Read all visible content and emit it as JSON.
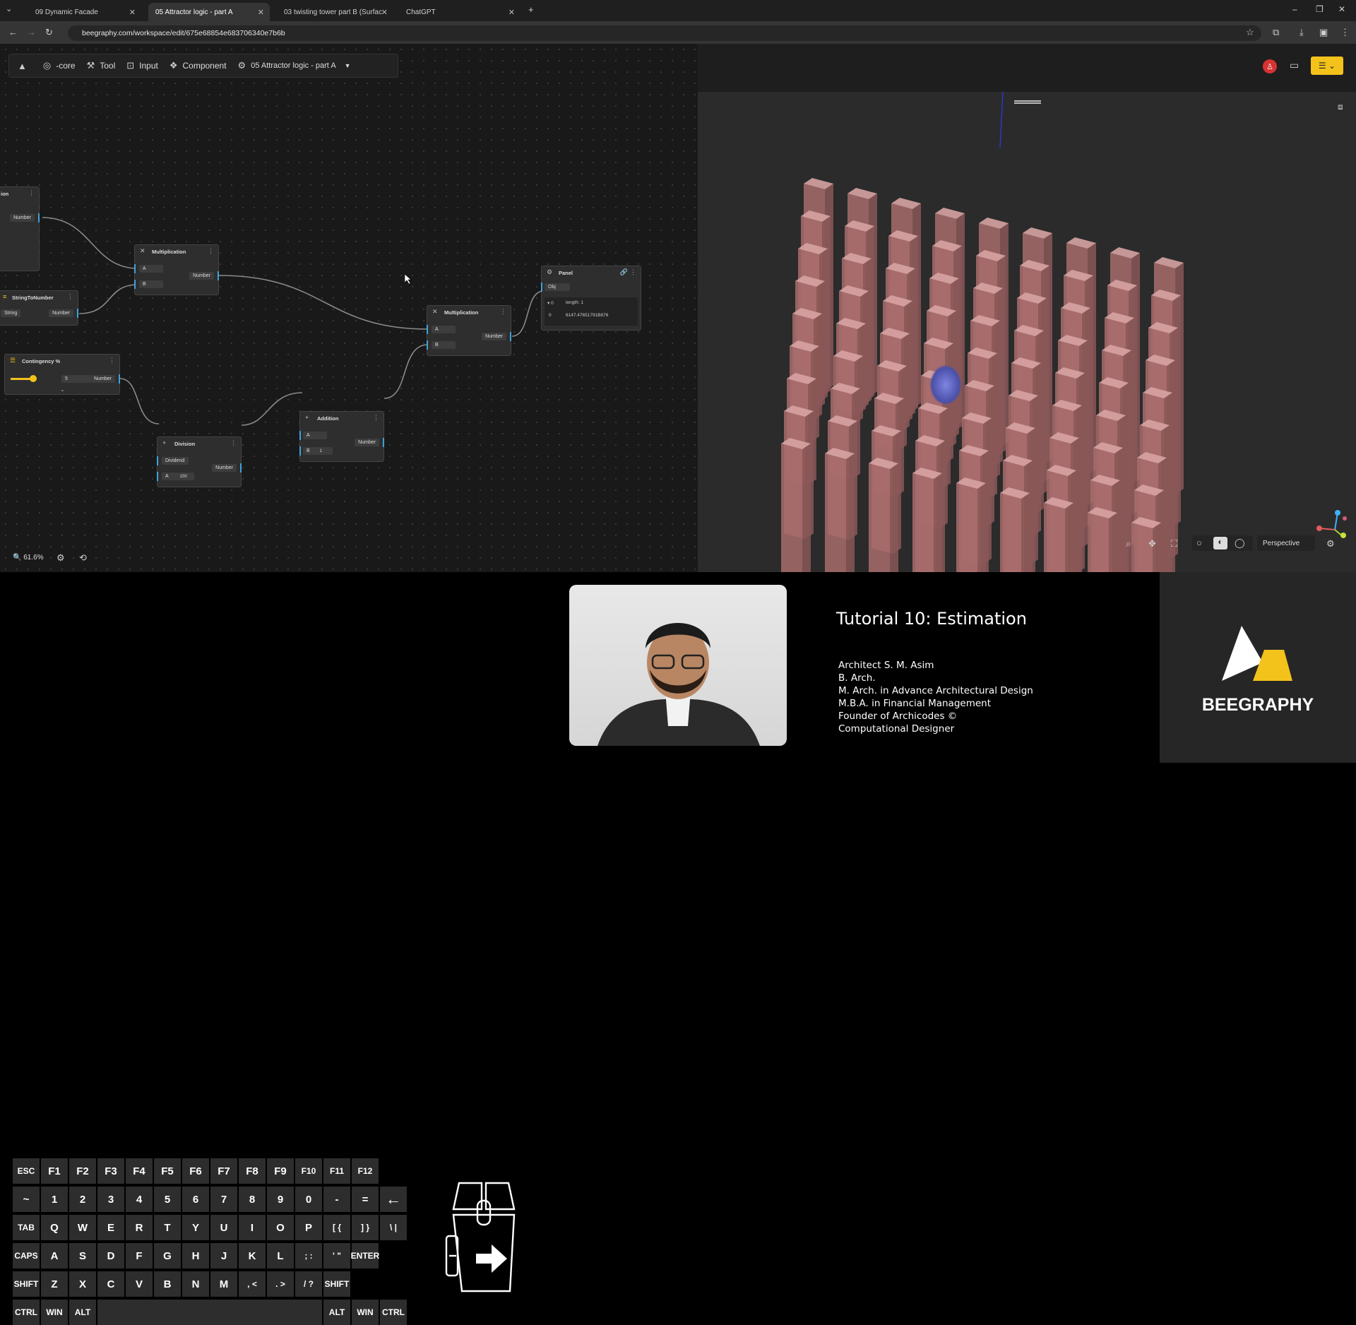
{
  "browser": {
    "tabs": [
      {
        "title": "09 Dynamic Facade",
        "active": false
      },
      {
        "title": "05 Attractor logic - part A",
        "active": true
      },
      {
        "title": "03 twisting tower part B (Surfac",
        "active": false
      },
      {
        "title": "ChatGPT",
        "active": false
      }
    ],
    "url": "beegraphy.com/workspace/edit/675e68854e683706340e7b6b"
  },
  "toolbar": {
    "core_label": "-core",
    "tool_label": "Tool",
    "input_label": "Input",
    "component_label": "Component",
    "file_label": "05 Attractor logic - part A"
  },
  "nodes": {
    "partial_top": {
      "title": "ion",
      "out": "Number"
    },
    "string_to_number": {
      "title": "StringToNumber",
      "in": "String",
      "out": "Number"
    },
    "contingency": {
      "title": "Contingency %",
      "value": "5",
      "out": "Number"
    },
    "multiplication1": {
      "title": "Multiplication",
      "a": "A",
      "b": "B",
      "out": "Number"
    },
    "division": {
      "title": "Division",
      "dividend": "Dividend",
      "a": "A",
      "a_val": "100",
      "out": "Number"
    },
    "addition": {
      "title": "Addition",
      "a": "A",
      "b": "B",
      "b_val": "1",
      "out": "Number"
    },
    "multiplication2": {
      "title": "Multiplication",
      "a": "A",
      "b": "B",
      "out": "Number"
    },
    "panel": {
      "title": "Panel",
      "obj": "Obj",
      "row1_key": "▾ 0",
      "row1_val": "length: 1",
      "row2_key": "0",
      "row2_val": "6147.47651791B876"
    }
  },
  "editor": {
    "zoom": "61.6%"
  },
  "viewport": {
    "camera": "Perspective"
  },
  "keyboard": {
    "rows": [
      [
        "ESC",
        "F1",
        "F2",
        "F3",
        "F4",
        "F5",
        "F6",
        "F7",
        "F8",
        "F9",
        "F10",
        "F11",
        "F12"
      ],
      [
        "~",
        "1",
        "2",
        "3",
        "4",
        "5",
        "6",
        "7",
        "8",
        "9",
        "0",
        "-",
        "=",
        "←"
      ],
      [
        "TAB",
        "Q",
        "W",
        "E",
        "R",
        "T",
        "Y",
        "U",
        "I",
        "O",
        "P",
        "[ {",
        "] }",
        "\\ |"
      ],
      [
        "CAPS",
        "A",
        "S",
        "D",
        "F",
        "G",
        "H",
        "J",
        "K",
        "L",
        "; :",
        "' \"",
        "ENTER"
      ],
      [
        "SHIFT",
        "Z",
        "X",
        "C",
        "V",
        "B",
        "N",
        "M",
        ", <",
        ". >",
        "/ ?",
        "SHIFT"
      ],
      [
        "CTRL",
        "WIN",
        "ALT",
        "ALT",
        "WIN",
        "CTRL"
      ]
    ]
  },
  "tutorial": {
    "title": "Tutorial 10: Estimation",
    "credits": [
      "Architect S. M. Asim",
      "B. Arch.",
      "M. Arch. in Advance Architectural Design",
      "M.B.A. in Financial Management",
      "Founder of Archicodes ©",
      "Computational Designer"
    ],
    "brand": "BEEGRAPHY"
  },
  "colors": {
    "accent_yellow": "#f3c21b",
    "pin_blue": "#3ea2d9",
    "tower": "#b97a7a"
  }
}
